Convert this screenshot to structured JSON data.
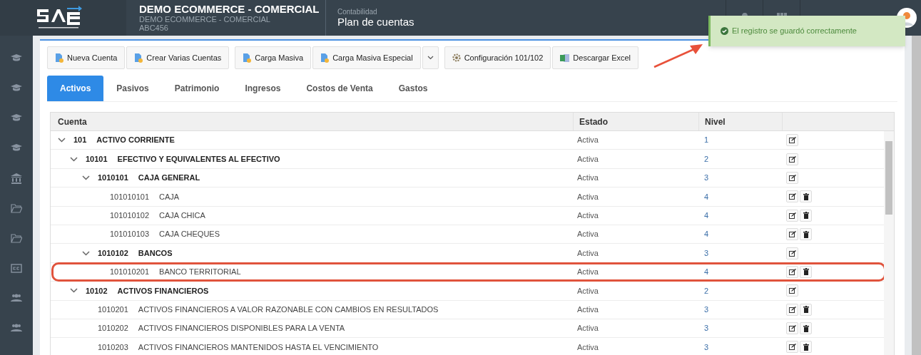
{
  "header": {
    "company": "DEMO ECOMMERCE - COMERCIAL",
    "company_sub": "DEMO ECOMMERCE - COMERCIAL",
    "company_code": "ABC456",
    "module": "Contabilidad",
    "page_title": "Plan de cuentas"
  },
  "toast": {
    "message": "El registro se guardó correctamente"
  },
  "toolbar": [
    {
      "label": "Nueva Cuenta",
      "kind": "file"
    },
    {
      "label": "Crear Varias Cuentas",
      "kind": "file"
    },
    {
      "label": "Carga Masiva",
      "kind": "file"
    },
    {
      "label": "Carga Masiva Especial",
      "kind": "file"
    },
    {
      "kind": "dropdown"
    },
    {
      "label": "Configuración 101/102",
      "kind": "gear"
    },
    {
      "label": "Descargar Excel",
      "kind": "excel"
    }
  ],
  "tabs": [
    {
      "label": "Activos",
      "selected": true
    },
    {
      "label": "Pasivos",
      "selected": false
    },
    {
      "label": "Patrimonio",
      "selected": false
    },
    {
      "label": "Ingresos",
      "selected": false
    },
    {
      "label": "Costos de Venta",
      "selected": false
    },
    {
      "label": "Gastos",
      "selected": false
    }
  ],
  "table": {
    "columns": [
      "Cuenta",
      "Estado",
      "Nivel"
    ],
    "rows": [
      {
        "code": "101",
        "name": "ACTIVO CORRIENTE",
        "estado": "Activa",
        "nivel": "1",
        "expanded": true,
        "deletable": false,
        "highlighted": false,
        "children": [
          {
            "code": "10101",
            "name": "EFECTIVO Y EQUIVALENTES AL EFECTIVO",
            "estado": "Activa",
            "nivel": "2",
            "expanded": true,
            "deletable": false,
            "highlighted": false,
            "children": [
              {
                "code": "1010101",
                "name": "CAJA GENERAL",
                "estado": "Activa",
                "nivel": "3",
                "expanded": true,
                "deletable": false,
                "highlighted": false,
                "children": [
                  {
                    "code": "101010101",
                    "name": "CAJA",
                    "estado": "Activa",
                    "nivel": "4",
                    "expanded": false,
                    "deletable": true,
                    "highlighted": false
                  },
                  {
                    "code": "101010102",
                    "name": "CAJA CHICA",
                    "estado": "Activa",
                    "nivel": "4",
                    "expanded": false,
                    "deletable": true,
                    "highlighted": false
                  },
                  {
                    "code": "101010103",
                    "name": "CAJA CHEQUES",
                    "estado": "Activa",
                    "nivel": "4",
                    "expanded": false,
                    "deletable": true,
                    "highlighted": false
                  }
                ]
              },
              {
                "code": "1010102",
                "name": "BANCOS",
                "estado": "Activa",
                "nivel": "3",
                "expanded": true,
                "deletable": false,
                "highlighted": false,
                "children": [
                  {
                    "code": "101010201",
                    "name": "BANCO TERRITORIAL",
                    "estado": "Activa",
                    "nivel": "4",
                    "expanded": false,
                    "deletable": true,
                    "highlighted": true
                  }
                ]
              }
            ]
          },
          {
            "code": "10102",
            "name": "ACTIVOS FINANCIEROS",
            "estado": "Activa",
            "nivel": "2",
            "expanded": true,
            "deletable": false,
            "highlighted": false,
            "children": [
              {
                "code": "1010201",
                "name": "ACTIVOS FINANCIEROS A VALOR RAZONABLE CON CAMBIOS EN RESULTADOS",
                "estado": "Activa",
                "nivel": "3",
                "expanded": false,
                "deletable": true,
                "highlighted": false
              },
              {
                "code": "1010202",
                "name": "ACTIVOS FINANCIEROS DISPONIBLES PARA LA VENTA",
                "estado": "Activa",
                "nivel": "3",
                "expanded": false,
                "deletable": true,
                "highlighted": false
              },
              {
                "code": "1010203",
                "name": "ACTIVOS FINANCIEROS MANTENIDOS HASTA EL VENCIMIENTO",
                "estado": "Activa",
                "nivel": "3",
                "expanded": false,
                "deletable": true,
                "highlighted": false
              }
            ]
          }
        ]
      }
    ]
  }
}
